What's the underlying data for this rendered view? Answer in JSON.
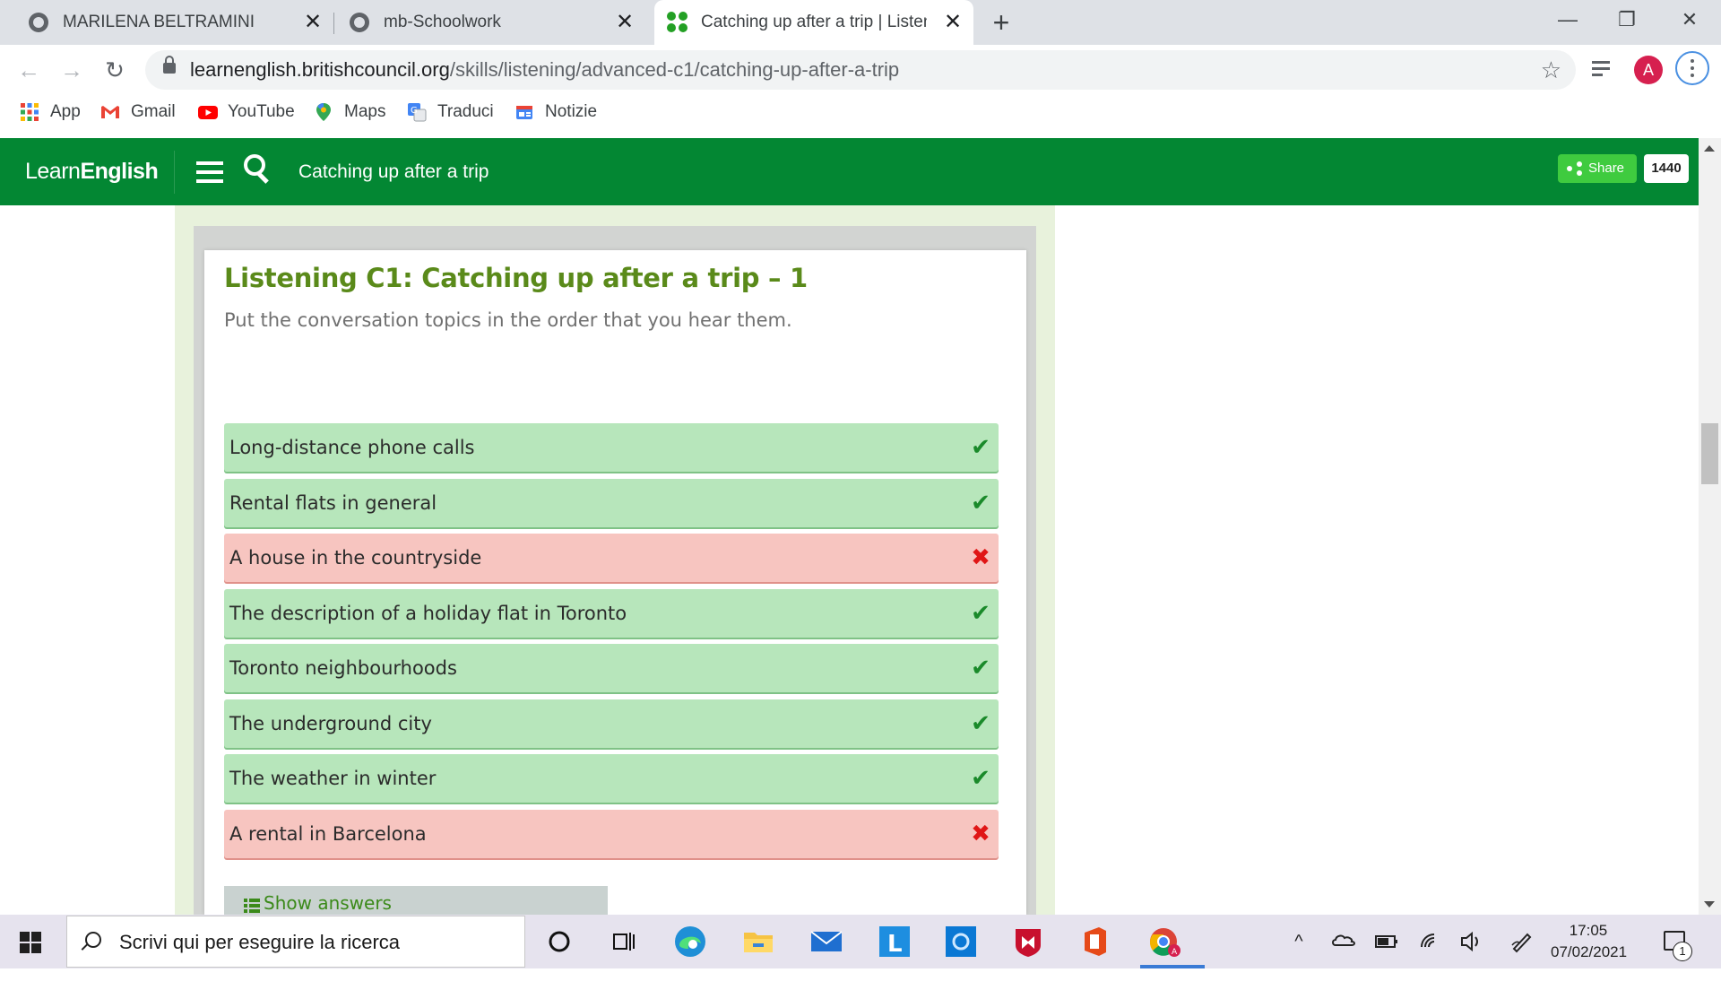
{
  "browser": {
    "tabs": [
      {
        "title": "MARILENA BELTRAMINI",
        "close": "✕"
      },
      {
        "title": "mb-Schoolwork",
        "close": "✕"
      },
      {
        "title": "Catching up after a trip | Listenin",
        "close": "✕"
      }
    ],
    "new_tab": "+",
    "window_controls": {
      "minimize": "—",
      "restore": "❐",
      "close": "✕"
    },
    "url_host": "learnenglish.britishcouncil.org",
    "url_path": "/skills/listening/advanced-c1/catching-up-after-a-trip",
    "profile_initial": "A",
    "bookmarks": [
      "App",
      "Gmail",
      "YouTube",
      "Maps",
      "Traduci",
      "Notizie"
    ]
  },
  "site": {
    "logo_light": "Learn",
    "logo_bold": "English",
    "header_title": "Catching up after a trip",
    "share_label": "Share",
    "share_count": "1440"
  },
  "exercise": {
    "title": "Listening C1: Catching up after a trip – 1",
    "instruction": "Put the conversation topics in the order that you hear them.",
    "items": [
      {
        "label": "Long-distance phone calls",
        "status": "correct"
      },
      {
        "label": "Rental flats in general",
        "status": "correct"
      },
      {
        "label": "A house in the countryside",
        "status": "wrong"
      },
      {
        "label": "The description of a holiday flat in Toronto",
        "status": "correct"
      },
      {
        "label": "Toronto neighbourhoods",
        "status": "correct"
      },
      {
        "label": "The underground city",
        "status": "correct"
      },
      {
        "label": "The weather in winter",
        "status": "correct"
      },
      {
        "label": "A rental in Barcelona",
        "status": "wrong"
      }
    ],
    "show_answers": "Show answers",
    "colors": {
      "correct": "#b7e6bb",
      "wrong": "#f7c5c0",
      "title": "#5a8a1a",
      "header": "#038733"
    }
  },
  "taskbar": {
    "search_placeholder": "Scrivi qui per eseguire la ricerca",
    "time": "17:05",
    "date": "07/02/2021",
    "notification_count": "1"
  }
}
